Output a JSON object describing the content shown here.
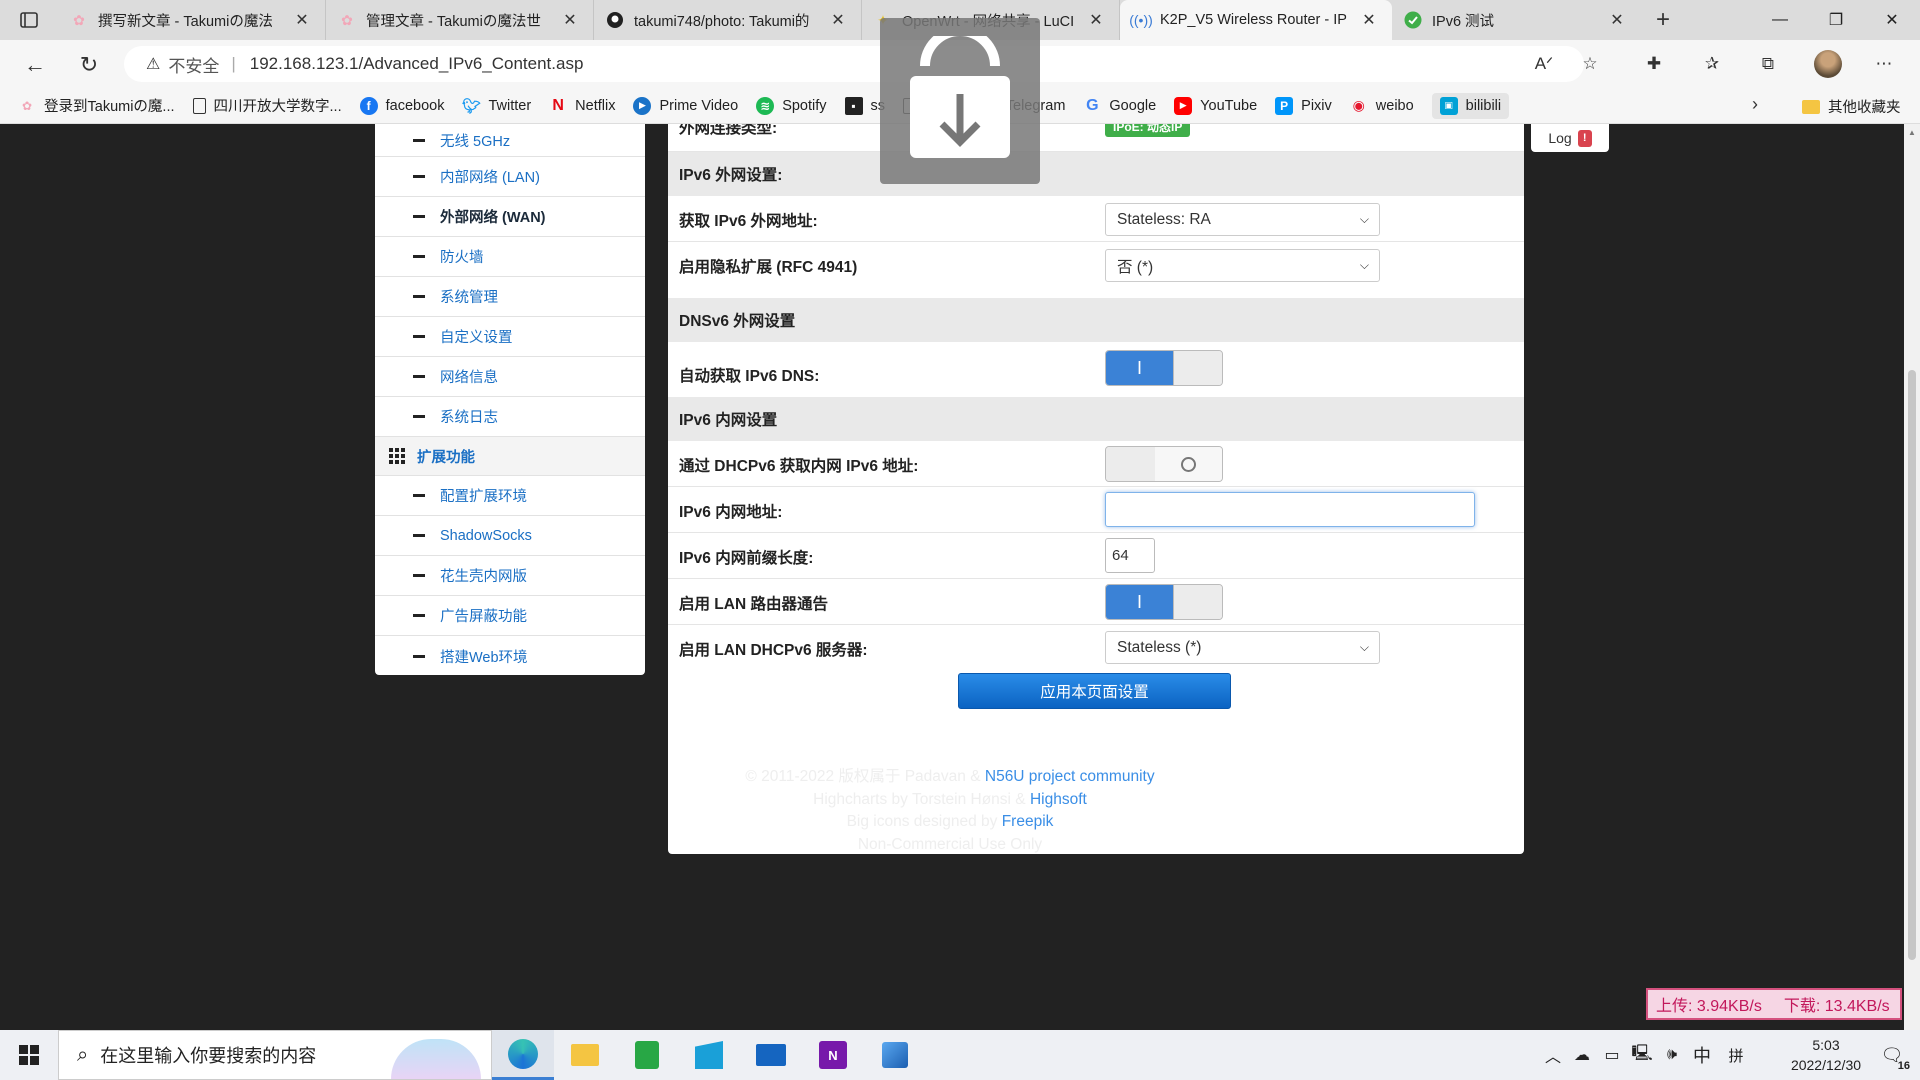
{
  "browser": {
    "tabs": [
      {
        "title": "撰写新文章 - Takumiの魔法",
        "favicon": "sakura-icon"
      },
      {
        "title": "管理文章 - Takumiの魔法世",
        "favicon": "sakura-icon"
      },
      {
        "title": "takumi748/photo: Takumi的",
        "favicon": "github-icon"
      },
      {
        "title": "OpenWrt - 网络共享 - LuCI",
        "favicon": "openwrt-icon"
      },
      {
        "title": "K2P_V5 Wireless Router - IP",
        "favicon": "wireless-icon"
      },
      {
        "title": "IPv6 测试",
        "favicon": "check-icon"
      }
    ],
    "address": {
      "insecure_label": "不安全",
      "url": "192.168.123.1/Advanced_IPv6_Content.asp"
    },
    "bookmarks": [
      {
        "label": "登录到Takumiの魔...",
        "icon": "sakura-icon"
      },
      {
        "label": "四川开放大学数字...",
        "icon": "doc-icon"
      },
      {
        "label": "facebook",
        "icon": "facebook-icon"
      },
      {
        "label": "Twitter",
        "icon": "twitter-icon"
      },
      {
        "label": "Netflix",
        "icon": "netflix-icon"
      },
      {
        "label": "Prime Video",
        "icon": "prime-icon"
      },
      {
        "label": "Spotify",
        "icon": "spotify-icon"
      },
      {
        "label": "ss",
        "icon": "ss-icon"
      },
      {
        "label": "pawoo",
        "icon": "doc-icon"
      },
      {
        "label": "Telegram",
        "icon": "doc-icon"
      },
      {
        "label": "Google",
        "icon": "google-icon"
      },
      {
        "label": "YouTube",
        "icon": "youtube-icon"
      },
      {
        "label": "Pixiv",
        "icon": "pixiv-icon"
      },
      {
        "label": "weibo",
        "icon": "weibo-icon"
      },
      {
        "label": "bilibili",
        "icon": "bilibili-icon"
      }
    ],
    "other_bookmarks": "其他收藏夹"
  },
  "sidebar": {
    "items": [
      {
        "label": "无线 5GHz",
        "current": false
      },
      {
        "label": "内部网络 (LAN)",
        "current": false
      },
      {
        "label": "外部网络 (WAN)",
        "current": true
      },
      {
        "label": "防火墙",
        "current": false
      },
      {
        "label": "系统管理",
        "current": false
      },
      {
        "label": "自定义设置",
        "current": false
      },
      {
        "label": "网络信息",
        "current": false
      },
      {
        "label": "系统日志",
        "current": false
      }
    ],
    "section": "扩展功能",
    "ext_items": [
      {
        "label": "配置扩展环境"
      },
      {
        "label": "ShadowSocks"
      },
      {
        "label": "花生壳内网版"
      },
      {
        "label": "广告屏蔽功能"
      },
      {
        "label": "搭建Web环境"
      }
    ]
  },
  "main": {
    "partial_top_label": "外网连接类型:",
    "partial_top_value": "IPoE: 动态IP",
    "ipv6_wan_head": "IPv6 外网设置:",
    "wan_addr_label": "获取 IPv6 外网地址:",
    "wan_addr_value": "Stateless: RA",
    "privacy_label": "启用隐私扩展 (RFC 4941)",
    "privacy_value": "否 (*)",
    "dnsv6_head": "DNSv6 外网设置",
    "auto_dns_label": "自动获取 IPv6 DNS:",
    "auto_dns_on": true,
    "lan_head": "IPv6 内网设置",
    "dhcpv6_label": "通过 DHCPv6 获取内网 IPv6 地址:",
    "dhcpv6_on": false,
    "lan_addr_label": "IPv6 内网地址:",
    "lan_addr_value": "",
    "prefix_label": "IPv6 内网前缀长度:",
    "prefix_value": "64",
    "ra_label": "启用 LAN 路由器通告",
    "ra_on": true,
    "lan_dhcp_label": "启用 LAN DHCPv6 服务器:",
    "lan_dhcp_value": "Stateless (*)",
    "apply_label": "应用本页面设置"
  },
  "log_button": {
    "label": "Log",
    "badge": "!"
  },
  "footer": {
    "line1_prefix": "© 2011-2022 版权属于 Padavan &",
    "line1_link": "N56U project community",
    "line2_prefix": "Highcharts by Torstein Hønsi &",
    "line2_link": "Highsoft",
    "line3_prefix": "Big icons designed by",
    "line3_link": "Freepik",
    "line4": "Non-Commercial Use Only"
  },
  "speed": {
    "upload": "上传: 3.94KB/s",
    "download": "下载: 13.4KB/s"
  },
  "taskbar": {
    "search_placeholder": "在这里输入你要搜索的内容",
    "ime": "中",
    "ime2": "拼",
    "time": "5:03",
    "date": "2022/12/30",
    "notifications": "16"
  },
  "colors": {
    "accent": "#3b82d6",
    "link": "#1a6fc4",
    "apply": "#0b63c2",
    "page_bg": "#222222"
  }
}
